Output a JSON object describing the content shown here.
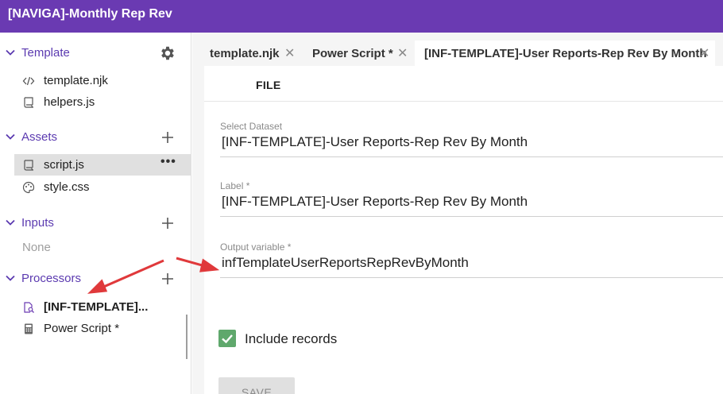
{
  "app": {
    "title": "[NAVIGA]-Monthly Rep Rev"
  },
  "sidebar": {
    "template": {
      "title": "Template",
      "items": [
        {
          "label": "template.njk",
          "icon": "code-icon"
        },
        {
          "label": "helpers.js",
          "icon": "script-icon"
        }
      ]
    },
    "assets": {
      "title": "Assets",
      "items": [
        {
          "label": "script.js",
          "icon": "script-icon",
          "menu": "•••"
        },
        {
          "label": "style.css",
          "icon": "palette-icon"
        }
      ]
    },
    "inputs": {
      "title": "Inputs",
      "empty": "None"
    },
    "processors": {
      "title": "Processors",
      "items": [
        {
          "label": "[INF-TEMPLATE]...",
          "icon": "dataset-search-icon"
        },
        {
          "label": "Power Script *",
          "icon": "calculator-icon"
        }
      ]
    }
  },
  "tabs": [
    {
      "label": "template.njk",
      "close": "✕"
    },
    {
      "label": "Power Script *",
      "close": "✕"
    },
    {
      "label": "[INF-TEMPLATE]-User Reports-Rep Rev By Month",
      "close": "✕"
    }
  ],
  "panel": {
    "menu_file": "FILE",
    "dataset": {
      "label": "Select Dataset",
      "value": "[INF-TEMPLATE]-User Reports-Rep Rev By Month"
    },
    "name": {
      "label": "Label *",
      "value": "[INF-TEMPLATE]-User Reports-Rep Rev By Month"
    },
    "output": {
      "label": "Output variable *",
      "value": "infTemplateUserReportsRepRevByMonth"
    },
    "include_records": {
      "label": "Include records",
      "checked": true
    },
    "save_label": "SAVE"
  },
  "colors": {
    "header": "#6a3ab2",
    "section_title": "#5b3ab0",
    "checkbox": "#5fa86c",
    "annotation_arrow": "#e0393b"
  }
}
